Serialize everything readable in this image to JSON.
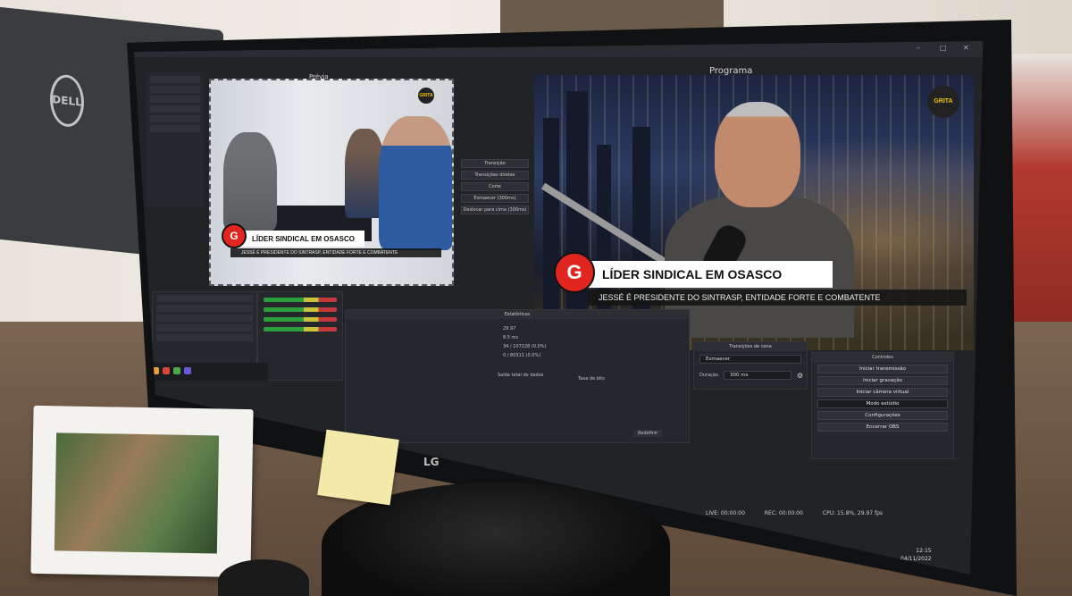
{
  "obs": {
    "preview_label": "Prévia",
    "program_label": "Programa",
    "lower_third": {
      "badge": "G",
      "title": "LÍDER SINDICAL EM OSASCO",
      "subtitle": "JESSÉ É PRESIDENTE DO SINTRASP, ENTIDADE FORTE E COMBATENTE",
      "logo": "GRITA"
    },
    "transition_panel": {
      "items": [
        "Transição",
        "Transições diretas",
        "Corte",
        "Esmaecer (300ms)",
        "Deslocar para cima (300ms)"
      ]
    },
    "scene_transitions": {
      "title": "Transições de cena",
      "transition": "Esmaecer",
      "duration_label": "Duração",
      "duration_value": "300 ms"
    },
    "controls": {
      "title": "Controles",
      "buttons": [
        "Iniciar transmissão",
        "Iniciar gravação",
        "Iniciar câmera virtual",
        "Modo estúdio",
        "Configurações",
        "Encerrar OBS"
      ]
    },
    "stats": {
      "title": "Estatísticas",
      "fps": "29.97",
      "render_time": "8.5 ms",
      "skipped": "34 / 107228 (0.0%)",
      "lagged": "0 / 80311 (0.0%)",
      "col_bitrate": "Taxa de bits",
      "col_data": "Saída total de dados",
      "reset_button": "Redefinir"
    },
    "status": {
      "live": "LIVE: 00:00:00",
      "rec": "REC: 00:00:00",
      "cpu": "CPU: 15.8%, 29.97 fps"
    },
    "clock": {
      "time": "12:15",
      "date": "04/11/2022"
    }
  },
  "scene": {
    "monitor_brand": "LG",
    "second_monitor_brand": "DELL"
  }
}
